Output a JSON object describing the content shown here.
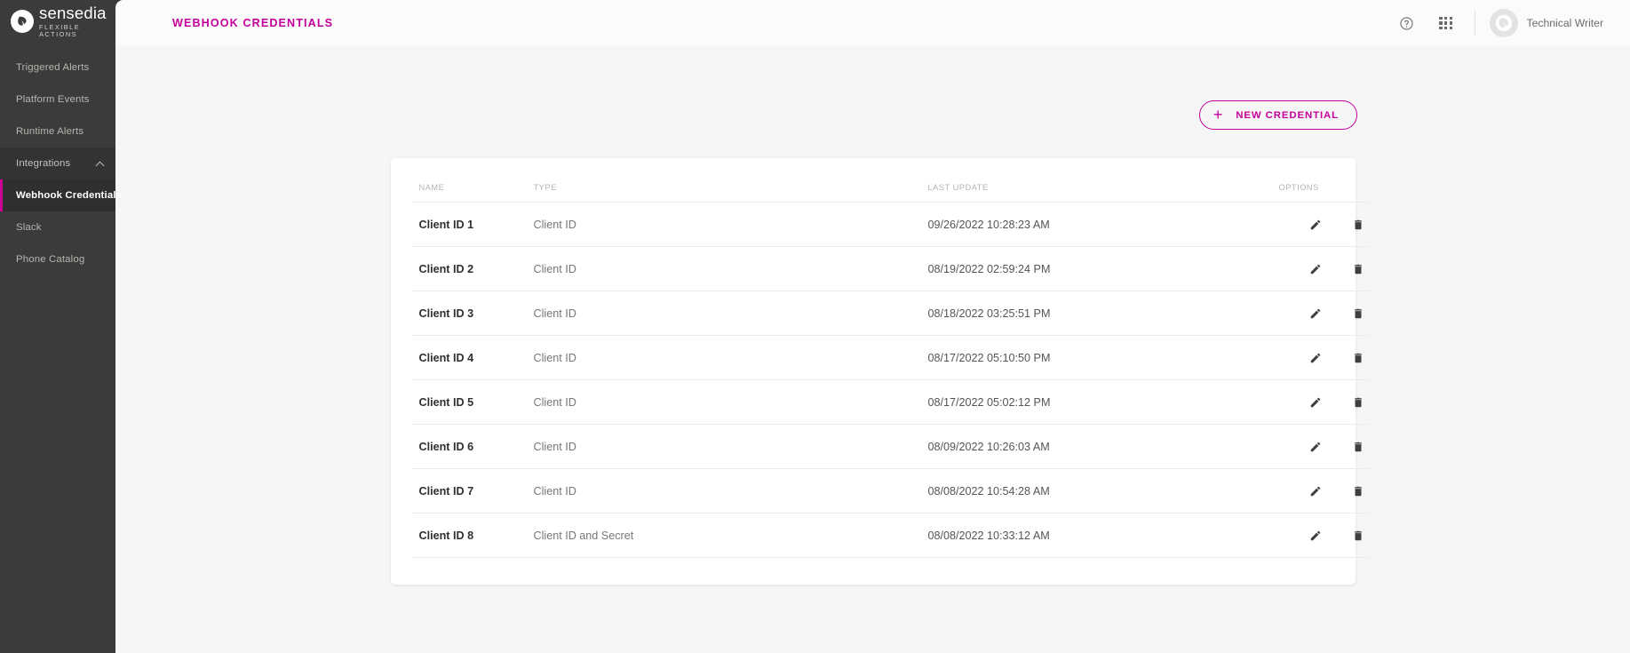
{
  "brand": {
    "logo_name": "sensedia",
    "logo_sub": "FLEXIBLE ACTIONS",
    "accent_color": "#c4009b",
    "sidebar_color": "#3b3b3b"
  },
  "sidebar": {
    "items": [
      {
        "label": "Triggered Alerts",
        "type": "link",
        "active": false
      },
      {
        "label": "Platform Events",
        "type": "link",
        "active": false
      },
      {
        "label": "Runtime Alerts",
        "type": "link",
        "active": false
      },
      {
        "label": "Integrations",
        "type": "group",
        "active": false,
        "expanded": true
      },
      {
        "label": "Webhook Credentials",
        "type": "sub",
        "active": true
      },
      {
        "label": "Slack",
        "type": "sub",
        "active": false
      },
      {
        "label": "Phone Catalog",
        "type": "sub",
        "active": false
      }
    ]
  },
  "header": {
    "title": "WEBHOOK CREDENTIALS",
    "help_icon": "help-circle-icon",
    "apps_icon": "apps-grid-icon",
    "user_name": "Technical Writer",
    "avatar_icon": "sensedia-avatar-icon"
  },
  "toolbar": {
    "new_credential_label": "NEW CREDENTIAL",
    "new_credential_plus": "+"
  },
  "table": {
    "columns": [
      "NAME",
      "TYPE",
      "LAST UPDATE",
      "OPTIONS"
    ],
    "rows": [
      {
        "name": "Client ID 1",
        "type": "Client ID",
        "last_update": "09/26/2022 10:28:23 AM"
      },
      {
        "name": "Client ID 2",
        "type": "Client ID",
        "last_update": "08/19/2022 02:59:24 PM"
      },
      {
        "name": "Client ID 3",
        "type": "Client ID",
        "last_update": "08/18/2022 03:25:51 PM"
      },
      {
        "name": "Client ID 4",
        "type": "Client ID",
        "last_update": "08/17/2022 05:10:50 PM"
      },
      {
        "name": "Client ID 5",
        "type": "Client ID",
        "last_update": "08/17/2022 05:02:12 PM"
      },
      {
        "name": "Client ID 6",
        "type": "Client ID",
        "last_update": "08/09/2022 10:26:03 AM"
      },
      {
        "name": "Client ID 7",
        "type": "Client ID",
        "last_update": "08/08/2022 10:54:28 AM"
      },
      {
        "name": "Client ID 8",
        "type": "Client ID and Secret",
        "last_update": "08/08/2022 10:33:12 AM"
      }
    ],
    "row_actions": [
      {
        "icon": "edit-pencil-icon"
      },
      {
        "icon": "delete-trash-icon"
      }
    ]
  }
}
